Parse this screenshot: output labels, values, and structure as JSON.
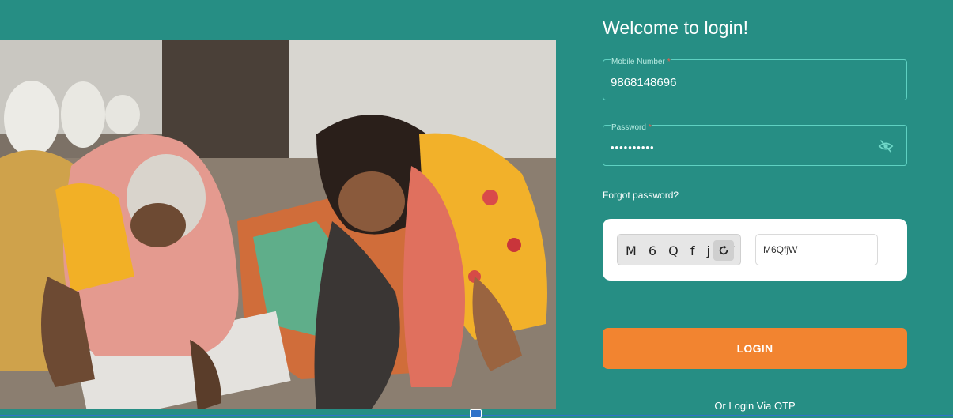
{
  "header": {
    "title": "Welcome to login!"
  },
  "form": {
    "mobile": {
      "label": "Mobile Number",
      "required_mark": "*",
      "value": "9868148696"
    },
    "password": {
      "label": "Password",
      "required_mark": "*",
      "value": "••••••••••",
      "toggle_icon": "eye-off-icon"
    },
    "forgot_password": "Forgot password?",
    "captcha": {
      "text": "M 6 Q f j W",
      "refresh_icon": "refresh-icon",
      "input_value": "M6QfjW"
    },
    "login_button": "LOGIN",
    "otp_link": "Or Login Via OTP"
  },
  "colors": {
    "background": "#268e84",
    "accent_border": "#5fd1c2",
    "button": "#f28430"
  }
}
